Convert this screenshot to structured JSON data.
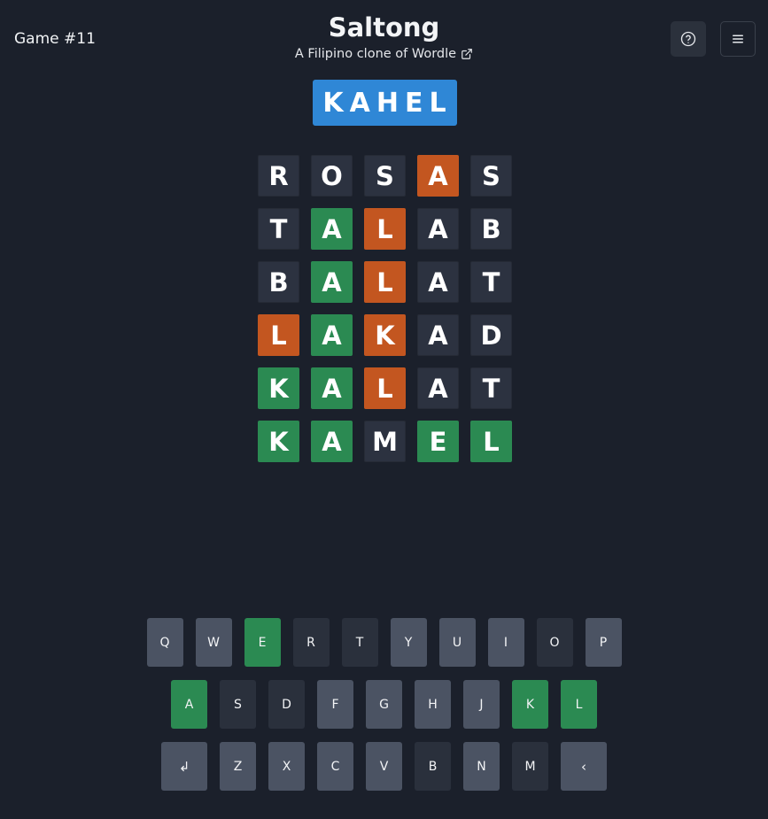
{
  "header": {
    "game_number": "Game #11",
    "title": "Saltong",
    "subtitle": "A Filipino clone of Wordle",
    "help_icon": "question-circle-icon",
    "menu_icon": "hamburger-menu-icon",
    "link_icon": "external-link-icon"
  },
  "answer": "KAHEL",
  "colors": {
    "background": "#1b202b",
    "answer": "#2f87d6",
    "correct": "#2b8a52",
    "present": "#c35620",
    "absent": "#2c3240",
    "unused_key": "#4b5363"
  },
  "board": {
    "rows": [
      [
        {
          "l": "R",
          "s": "absent"
        },
        {
          "l": "O",
          "s": "absent"
        },
        {
          "l": "S",
          "s": "absent"
        },
        {
          "l": "A",
          "s": "present"
        },
        {
          "l": "S",
          "s": "absent"
        }
      ],
      [
        {
          "l": "T",
          "s": "absent"
        },
        {
          "l": "A",
          "s": "correct"
        },
        {
          "l": "L",
          "s": "present"
        },
        {
          "l": "A",
          "s": "absent"
        },
        {
          "l": "B",
          "s": "absent"
        }
      ],
      [
        {
          "l": "B",
          "s": "absent"
        },
        {
          "l": "A",
          "s": "correct"
        },
        {
          "l": "L",
          "s": "present"
        },
        {
          "l": "A",
          "s": "absent"
        },
        {
          "l": "T",
          "s": "absent"
        }
      ],
      [
        {
          "l": "L",
          "s": "present"
        },
        {
          "l": "A",
          "s": "correct"
        },
        {
          "l": "K",
          "s": "present"
        },
        {
          "l": "A",
          "s": "absent"
        },
        {
          "l": "D",
          "s": "absent"
        }
      ],
      [
        {
          "l": "K",
          "s": "correct"
        },
        {
          "l": "A",
          "s": "correct"
        },
        {
          "l": "L",
          "s": "present"
        },
        {
          "l": "A",
          "s": "absent"
        },
        {
          "l": "T",
          "s": "absent"
        }
      ],
      [
        {
          "l": "K",
          "s": "correct"
        },
        {
          "l": "A",
          "s": "correct"
        },
        {
          "l": "M",
          "s": "absent"
        },
        {
          "l": "E",
          "s": "correct"
        },
        {
          "l": "L",
          "s": "correct"
        }
      ]
    ]
  },
  "keyboard": {
    "rows": [
      [
        {
          "k": "Q",
          "s": "unused"
        },
        {
          "k": "W",
          "s": "unused"
        },
        {
          "k": "E",
          "s": "correct"
        },
        {
          "k": "R",
          "s": "absent"
        },
        {
          "k": "T",
          "s": "absent"
        },
        {
          "k": "Y",
          "s": "unused"
        },
        {
          "k": "U",
          "s": "unused"
        },
        {
          "k": "I",
          "s": "unused"
        },
        {
          "k": "O",
          "s": "absent"
        },
        {
          "k": "P",
          "s": "unused"
        }
      ],
      [
        {
          "k": "A",
          "s": "correct"
        },
        {
          "k": "S",
          "s": "absent"
        },
        {
          "k": "D",
          "s": "absent"
        },
        {
          "k": "F",
          "s": "unused"
        },
        {
          "k": "G",
          "s": "unused"
        },
        {
          "k": "H",
          "s": "unused"
        },
        {
          "k": "J",
          "s": "unused"
        },
        {
          "k": "K",
          "s": "correct"
        },
        {
          "k": "L",
          "s": "correct"
        }
      ],
      [
        {
          "k": "↲",
          "s": "unused",
          "wide": true,
          "name": "enter-key"
        },
        {
          "k": "Z",
          "s": "unused"
        },
        {
          "k": "X",
          "s": "unused"
        },
        {
          "k": "C",
          "s": "unused"
        },
        {
          "k": "V",
          "s": "unused"
        },
        {
          "k": "B",
          "s": "absent"
        },
        {
          "k": "N",
          "s": "unused"
        },
        {
          "k": "M",
          "s": "absent"
        },
        {
          "k": "‹",
          "s": "unused",
          "wide": true,
          "name": "backspace-key"
        }
      ]
    ]
  }
}
